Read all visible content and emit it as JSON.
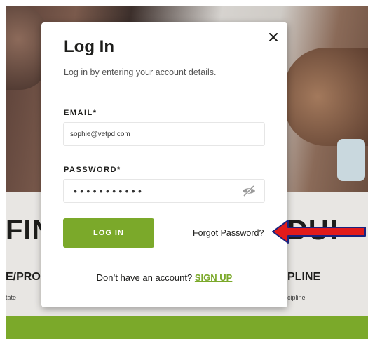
{
  "background": {
    "heading_left": "FIN",
    "heading_right": "DU!",
    "sub_left": "E/PRO",
    "sub_left_small": "tate",
    "sub_right": "PLINE",
    "sub_right_small": "cipline"
  },
  "modal": {
    "title": "Log In",
    "subtitle": "Log in by entering your account details.",
    "close_icon": "close-icon",
    "email_label": "EMAIL*",
    "email_value": "sophie@vetpd.com",
    "password_label": "PASSWORD*",
    "password_masked": "•••••••••••",
    "password_toggle_icon": "eye-slash-icon",
    "login_button": "LOG IN",
    "forgot_password": "Forgot Password?",
    "signup_prompt": "Don’t have an account?",
    "signup_link": "SIGN UP"
  },
  "colors": {
    "accent": "#7ba92a",
    "annotation_arrow": "#e11b1b"
  }
}
